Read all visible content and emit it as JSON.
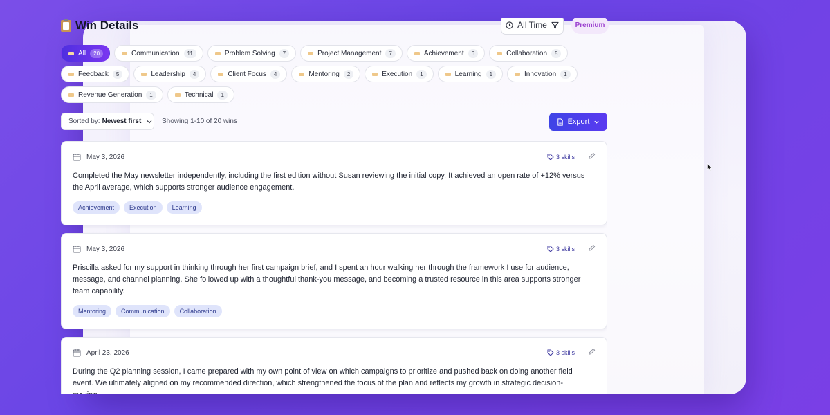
{
  "header": {
    "title": "Win Details",
    "time_filter": "All Time",
    "badge": "Premium"
  },
  "filters": [
    [
      {
        "label": "All",
        "count": "20",
        "active": true
      },
      {
        "label": "Communication",
        "count": "11"
      },
      {
        "label": "Problem Solving",
        "count": "7"
      },
      {
        "label": "Project Management",
        "count": "7"
      },
      {
        "label": "Achievement",
        "count": "6"
      },
      {
        "label": "Collaboration",
        "count": "5"
      }
    ],
    [
      {
        "label": "Feedback",
        "count": "5"
      },
      {
        "label": "Leadership",
        "count": "4"
      },
      {
        "label": "Client Focus",
        "count": "4"
      },
      {
        "label": "Mentoring",
        "count": "2"
      },
      {
        "label": "Execution",
        "count": "1"
      },
      {
        "label": "Learning",
        "count": "1"
      },
      {
        "label": "Innovation",
        "count": "1"
      }
    ],
    [
      {
        "label": "Revenue Generation",
        "count": "1"
      },
      {
        "label": "Technical",
        "count": "1"
      }
    ]
  ],
  "toolbar": {
    "sort_prefix": "Sorted by:",
    "sort_value": "Newest first",
    "showing": "Showing 1-10 of 20 wins",
    "export_label": "Export"
  },
  "wins": [
    {
      "date": "May 3, 2026",
      "skills": "3 skills",
      "text": "Completed the May newsletter independently, including the first edition without Susan reviewing the initial copy. It achieved an open rate of +12% versus the April average, which supports stronger audience engagement.",
      "tags": [
        "Achievement",
        "Execution",
        "Learning"
      ]
    },
    {
      "date": "May 3, 2026",
      "skills": "3 skills",
      "text": "Priscilla asked for my support in thinking through her first campaign brief, and I spent an hour walking her through the framework I use for audience, message, and channel planning. She followed up with a thoughtful thank-you message, and becoming a trusted resource in this area supports stronger team capability.",
      "tags": [
        "Mentoring",
        "Communication",
        "Collaboration"
      ]
    },
    {
      "date": "April 23, 2026",
      "skills": "3 skills",
      "text": "During the Q2 planning session, I came prepared with my own point of view on which campaigns to prioritize and pushed back on doing another field event. We ultimately aligned on my recommended direction, which strengthened the focus of the plan and reflects my growth in strategic decision-making.",
      "tags": []
    }
  ]
}
